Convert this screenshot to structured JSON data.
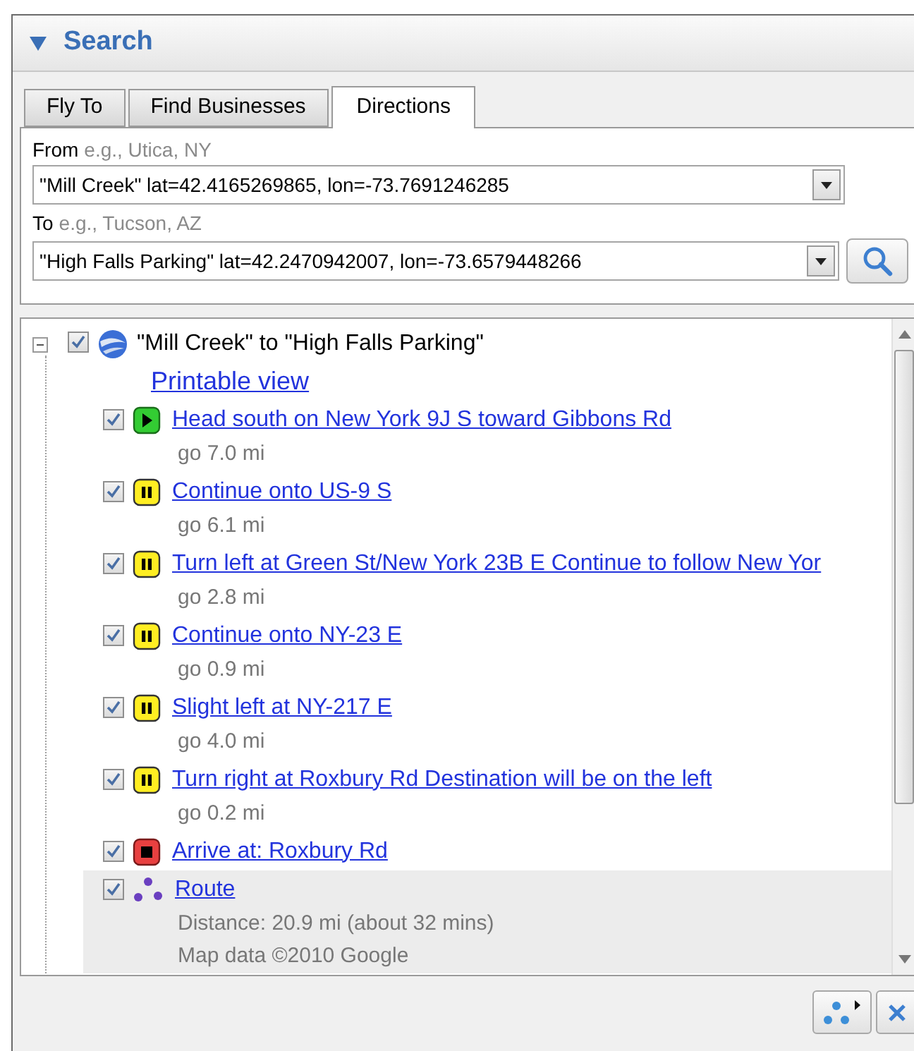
{
  "panel": {
    "title": "Search",
    "expanded": true
  },
  "tabs": [
    {
      "label": "Fly To",
      "selected": false
    },
    {
      "label": "Find Businesses",
      "selected": false
    },
    {
      "label": "Directions",
      "selected": true
    }
  ],
  "from": {
    "label": "From",
    "hint": "e.g., Utica, NY",
    "value": "\"Mill Creek\" lat=42.4165269865, lon=-73.7691246285"
  },
  "to": {
    "label": "To",
    "hint": "e.g., Tucson, AZ",
    "value": "\"High Falls Parking\" lat=42.2470942007, lon=-73.6579448266"
  },
  "results": {
    "title": "\"Mill Creek\" to \"High Falls Parking\"",
    "checked": true,
    "expanded": true,
    "link": "Printable view",
    "children": [
      {
        "kind": "start",
        "checked": true,
        "text": "Head south on New York 9J S toward Gibbons Rd",
        "detail": "go 7.0 mi"
      },
      {
        "kind": "step",
        "checked": true,
        "text": "Continue onto US-9 S",
        "detail": "go 6.1 mi"
      },
      {
        "kind": "step",
        "checked": true,
        "text": "Turn left at Green St/New York 23B E Continue to follow New Yor",
        "detail": "go 2.8 mi"
      },
      {
        "kind": "step",
        "checked": true,
        "text": "Continue onto NY-23 E",
        "detail": "go 0.9 mi"
      },
      {
        "kind": "step",
        "checked": true,
        "text": "Slight left at NY-217 E",
        "detail": "go 4.0 mi"
      },
      {
        "kind": "step",
        "checked": true,
        "text": "Turn right at Roxbury Rd Destination will be on the left",
        "detail": "go 0.2 mi"
      },
      {
        "kind": "end",
        "checked": true,
        "text": "Arrive at: Roxbury Rd"
      },
      {
        "kind": "route",
        "checked": true,
        "selected": true,
        "text": "Route",
        "details": [
          "Distance: 20.9 mi (about 32 mins)",
          "Map data ©2010 Google"
        ]
      }
    ]
  }
}
